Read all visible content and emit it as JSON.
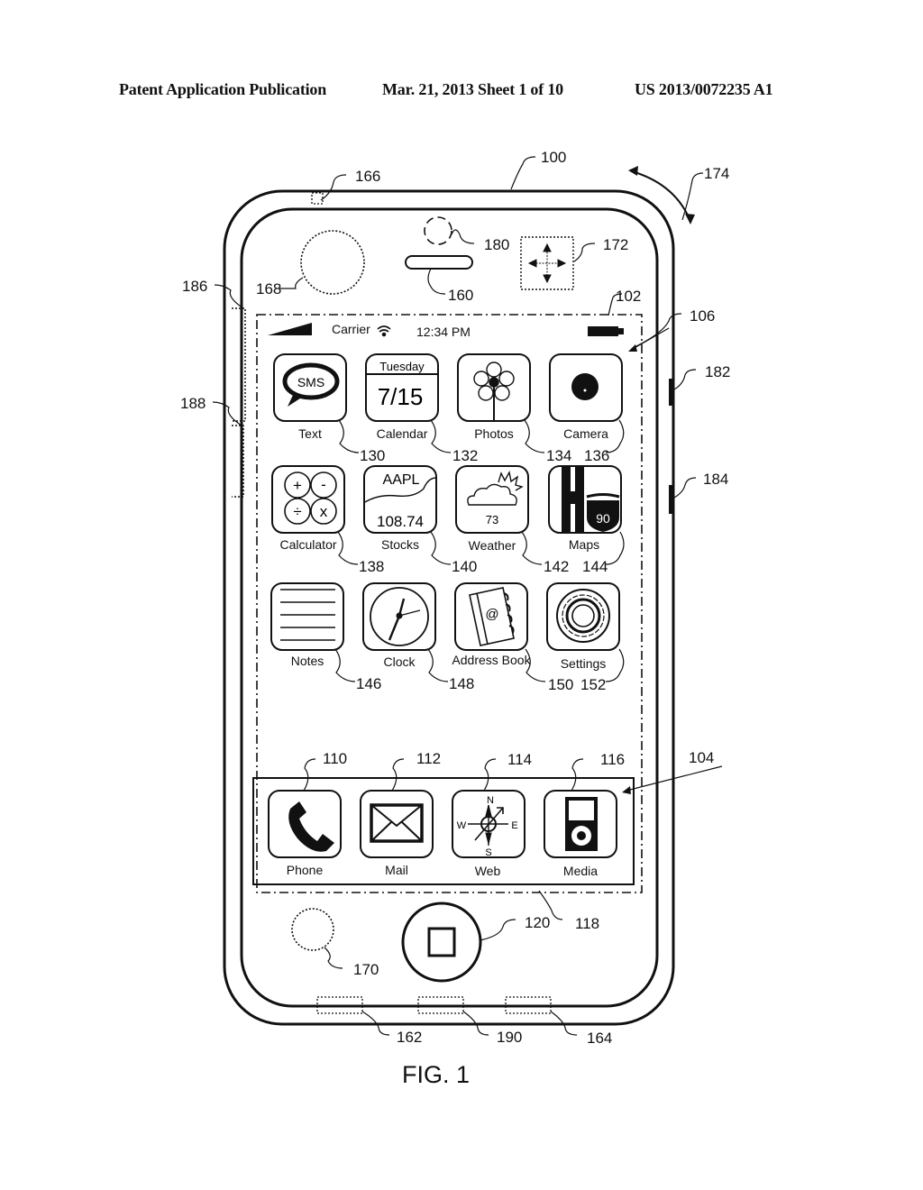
{
  "header": {
    "publication": "Patent Application Publication",
    "date_sheet": "Mar. 21, 2013  Sheet 1 of 10",
    "number": "US 2013/0072235 A1"
  },
  "figure_caption": "FIG. 1",
  "status_bar": {
    "carrier": "Carrier",
    "time": "12:34 PM",
    "icons": [
      "signal-strength-icon",
      "wifi-icon",
      "battery-icon"
    ]
  },
  "apps": [
    {
      "name": "Text",
      "ref": "130",
      "icon": "sms-bubble-icon",
      "icon_text": "SMS"
    },
    {
      "name": "Calendar",
      "ref": "132",
      "icon": "calendar-icon",
      "icon_day": "Tuesday",
      "icon_date": "7/15"
    },
    {
      "name": "Photos",
      "ref": "134",
      "icon": "flower-icon"
    },
    {
      "name": "Camera",
      "ref": "136",
      "icon": "camera-lens-icon"
    },
    {
      "name": "Calculator",
      "ref": "138",
      "icon": "calculator-icon",
      "icon_symbols": [
        "+",
        "-",
        "÷",
        "x"
      ]
    },
    {
      "name": "Stocks",
      "ref": "140",
      "icon": "stock-chart-icon",
      "icon_ticker": "AAPL",
      "icon_value": "108.74"
    },
    {
      "name": "Weather",
      "ref": "142",
      "icon": "sun-cloud-icon",
      "icon_value": "73"
    },
    {
      "name": "Maps",
      "ref": "144",
      "icon": "map-road-icon",
      "icon_value": "90"
    },
    {
      "name": "Notes",
      "ref": "146",
      "icon": "notes-lines-icon"
    },
    {
      "name": "Clock",
      "ref": "148",
      "icon": "clock-icon"
    },
    {
      "name": "Address Book",
      "ref": "150",
      "icon": "address-book-icon",
      "icon_text": "@"
    },
    {
      "name": "Settings",
      "ref": "152",
      "icon": "gear-icon"
    }
  ],
  "dock": [
    {
      "name": "Phone",
      "ref": "110",
      "icon": "phone-handset-icon"
    },
    {
      "name": "Mail",
      "ref": "112",
      "icon": "envelope-icon"
    },
    {
      "name": "Web",
      "ref": "114",
      "icon": "compass-icon",
      "compass": [
        "N",
        "E",
        "S",
        "W"
      ]
    },
    {
      "name": "Media",
      "ref": "116",
      "icon": "media-player-icon"
    }
  ],
  "reference_numerals": {
    "device": "100",
    "touch_screen": "102",
    "tray": "104",
    "home_screen": "106",
    "home_button": "120",
    "screen_area": "118",
    "speaker": "160",
    "microphone": "162",
    "speaker_bottom": "164",
    "top_sensor": "166",
    "front_camera_area": "168",
    "bottom_sensor": "170",
    "accelerometer": "172",
    "rotation": "174",
    "front_camera": "180",
    "button_upper": "182",
    "button_lower": "184",
    "side_sensor_upper": "186",
    "side_sensor_lower": "188",
    "connector": "190"
  }
}
